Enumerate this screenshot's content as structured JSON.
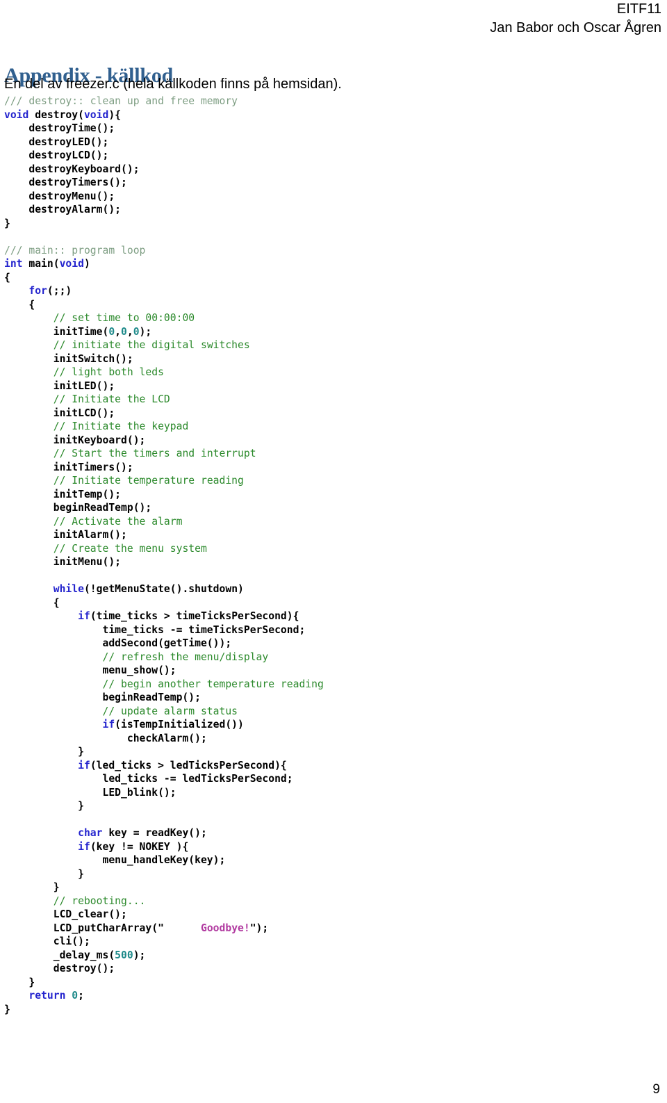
{
  "header": {
    "course_code": "EITF11",
    "authors": "Jan Babor och Oscar Ågren"
  },
  "title": "Appendix - källkod",
  "subtitle": "En del av freezer.c  (hela källkoden finns på hemsidan).",
  "footer": {
    "page_number": "9"
  },
  "colors": {
    "title": "#31608F",
    "keyword": "#2424CE",
    "comment": "#2C8A2C",
    "doc_comment": "#7E9E83",
    "number": "#1E8A8A",
    "string": "#B13AA0",
    "text": "#000000",
    "background": "#FFFFFF"
  },
  "code": {
    "language": "c",
    "lines": [
      [
        {
          "t": "/// destroy:: clean up and free memory",
          "c": "cmt-doc"
        }
      ],
      [
        {
          "t": "void",
          "c": "kw"
        },
        {
          "t": " destroy(",
          "c": "plain"
        },
        {
          "t": "void",
          "c": "kw"
        },
        {
          "t": "){",
          "c": "plain"
        }
      ],
      [
        {
          "t": "    destroyTime();",
          "c": "plain"
        }
      ],
      [
        {
          "t": "    destroyLED();",
          "c": "plain"
        }
      ],
      [
        {
          "t": "    destroyLCD();",
          "c": "plain"
        }
      ],
      [
        {
          "t": "    destroyKeyboard();",
          "c": "plain"
        }
      ],
      [
        {
          "t": "    destroyTimers();",
          "c": "plain"
        }
      ],
      [
        {
          "t": "    destroyMenu();",
          "c": "plain"
        }
      ],
      [
        {
          "t": "    destroyAlarm();",
          "c": "plain"
        }
      ],
      [
        {
          "t": "}",
          "c": "plain"
        }
      ],
      [
        {
          "t": "",
          "c": "plain"
        }
      ],
      [
        {
          "t": "/// main:: program loop",
          "c": "cmt-doc"
        }
      ],
      [
        {
          "t": "int",
          "c": "kw"
        },
        {
          "t": " main(",
          "c": "plain"
        },
        {
          "t": "void",
          "c": "kw"
        },
        {
          "t": ")",
          "c": "plain"
        }
      ],
      [
        {
          "t": "{",
          "c": "plain"
        }
      ],
      [
        {
          "t": "    ",
          "c": "plain"
        },
        {
          "t": "for",
          "c": "kw"
        },
        {
          "t": "(;;)",
          "c": "plain"
        }
      ],
      [
        {
          "t": "    {",
          "c": "plain"
        }
      ],
      [
        {
          "t": "        ",
          "c": "plain"
        },
        {
          "t": "// set time to 00:00:00",
          "c": "cmt"
        }
      ],
      [
        {
          "t": "        initTime(",
          "c": "plain"
        },
        {
          "t": "0",
          "c": "num"
        },
        {
          "t": ",",
          "c": "plain"
        },
        {
          "t": "0",
          "c": "num"
        },
        {
          "t": ",",
          "c": "plain"
        },
        {
          "t": "0",
          "c": "num"
        },
        {
          "t": ");",
          "c": "plain"
        }
      ],
      [
        {
          "t": "        ",
          "c": "plain"
        },
        {
          "t": "// initiate the digital switches",
          "c": "cmt"
        }
      ],
      [
        {
          "t": "        initSwitch();",
          "c": "plain"
        }
      ],
      [
        {
          "t": "        ",
          "c": "plain"
        },
        {
          "t": "// light both leds",
          "c": "cmt"
        }
      ],
      [
        {
          "t": "        initLED();",
          "c": "plain"
        }
      ],
      [
        {
          "t": "        ",
          "c": "plain"
        },
        {
          "t": "// Initiate the LCD",
          "c": "cmt"
        }
      ],
      [
        {
          "t": "        initLCD();",
          "c": "plain"
        }
      ],
      [
        {
          "t": "        ",
          "c": "plain"
        },
        {
          "t": "// Initiate the keypad",
          "c": "cmt"
        }
      ],
      [
        {
          "t": "        initKeyboard();",
          "c": "plain"
        }
      ],
      [
        {
          "t": "        ",
          "c": "plain"
        },
        {
          "t": "// Start the timers and interrupt",
          "c": "cmt"
        }
      ],
      [
        {
          "t": "        initTimers();",
          "c": "plain"
        }
      ],
      [
        {
          "t": "        ",
          "c": "plain"
        },
        {
          "t": "// Initiate temperature reading",
          "c": "cmt"
        }
      ],
      [
        {
          "t": "        initTemp();",
          "c": "plain"
        }
      ],
      [
        {
          "t": "        beginReadTemp();",
          "c": "plain"
        }
      ],
      [
        {
          "t": "        ",
          "c": "plain"
        },
        {
          "t": "// Activate the alarm",
          "c": "cmt"
        }
      ],
      [
        {
          "t": "        initAlarm();",
          "c": "plain"
        }
      ],
      [
        {
          "t": "        ",
          "c": "plain"
        },
        {
          "t": "// Create the menu system",
          "c": "cmt"
        }
      ],
      [
        {
          "t": "        initMenu();",
          "c": "plain"
        }
      ],
      [
        {
          "t": "",
          "c": "plain"
        }
      ],
      [
        {
          "t": "        ",
          "c": "plain"
        },
        {
          "t": "while",
          "c": "kw"
        },
        {
          "t": "(!getMenuState().shutdown)",
          "c": "plain"
        }
      ],
      [
        {
          "t": "        {",
          "c": "plain"
        }
      ],
      [
        {
          "t": "            ",
          "c": "plain"
        },
        {
          "t": "if",
          "c": "kw"
        },
        {
          "t": "(time_ticks > timeTicksPerSecond){",
          "c": "plain"
        }
      ],
      [
        {
          "t": "                time_ticks -= timeTicksPerSecond;",
          "c": "plain"
        }
      ],
      [
        {
          "t": "                addSecond(getTime());",
          "c": "plain"
        }
      ],
      [
        {
          "t": "                ",
          "c": "plain"
        },
        {
          "t": "// refresh the menu/display",
          "c": "cmt"
        }
      ],
      [
        {
          "t": "                menu_show();",
          "c": "plain"
        }
      ],
      [
        {
          "t": "                ",
          "c": "plain"
        },
        {
          "t": "// begin another temperature reading",
          "c": "cmt"
        }
      ],
      [
        {
          "t": "                beginReadTemp();",
          "c": "plain"
        }
      ],
      [
        {
          "t": "                ",
          "c": "plain"
        },
        {
          "t": "// update alarm status",
          "c": "cmt"
        }
      ],
      [
        {
          "t": "                ",
          "c": "plain"
        },
        {
          "t": "if",
          "c": "kw"
        },
        {
          "t": "(isTempInitialized())",
          "c": "plain"
        }
      ],
      [
        {
          "t": "                    checkAlarm();",
          "c": "plain"
        }
      ],
      [
        {
          "t": "            }",
          "c": "plain"
        }
      ],
      [
        {
          "t": "            ",
          "c": "plain"
        },
        {
          "t": "if",
          "c": "kw"
        },
        {
          "t": "(led_ticks > ledTicksPerSecond){",
          "c": "plain"
        }
      ],
      [
        {
          "t": "                led_ticks -= ledTicksPerSecond;",
          "c": "plain"
        }
      ],
      [
        {
          "t": "                LED_blink();",
          "c": "plain"
        }
      ],
      [
        {
          "t": "            }",
          "c": "plain"
        }
      ],
      [
        {
          "t": "",
          "c": "plain"
        }
      ],
      [
        {
          "t": "            ",
          "c": "plain"
        },
        {
          "t": "char",
          "c": "kw"
        },
        {
          "t": " key = readKey();",
          "c": "plain"
        }
      ],
      [
        {
          "t": "            ",
          "c": "plain"
        },
        {
          "t": "if",
          "c": "kw"
        },
        {
          "t": "(key != NOKEY ){",
          "c": "plain"
        }
      ],
      [
        {
          "t": "                menu_handleKey(key);",
          "c": "plain"
        }
      ],
      [
        {
          "t": "            }",
          "c": "plain"
        }
      ],
      [
        {
          "t": "        }",
          "c": "plain"
        }
      ],
      [
        {
          "t": "        ",
          "c": "plain"
        },
        {
          "t": "// rebooting...",
          "c": "cmt"
        }
      ],
      [
        {
          "t": "        LCD_clear();",
          "c": "plain"
        }
      ],
      [
        {
          "t": "        LCD_putCharArray(\"",
          "c": "plain"
        },
        {
          "t": "      Goodbye!",
          "c": "str"
        },
        {
          "t": "\");",
          "c": "plain"
        }
      ],
      [
        {
          "t": "        cli();",
          "c": "plain"
        }
      ],
      [
        {
          "t": "        _delay_ms(",
          "c": "plain"
        },
        {
          "t": "500",
          "c": "num"
        },
        {
          "t": ");",
          "c": "plain"
        }
      ],
      [
        {
          "t": "        destroy();",
          "c": "plain"
        }
      ],
      [
        {
          "t": "    }",
          "c": "plain"
        }
      ],
      [
        {
          "t": "    ",
          "c": "plain"
        },
        {
          "t": "return",
          "c": "kw"
        },
        {
          "t": " ",
          "c": "plain"
        },
        {
          "t": "0",
          "c": "num"
        },
        {
          "t": ";",
          "c": "plain"
        }
      ],
      [
        {
          "t": "}",
          "c": "plain"
        }
      ]
    ]
  }
}
